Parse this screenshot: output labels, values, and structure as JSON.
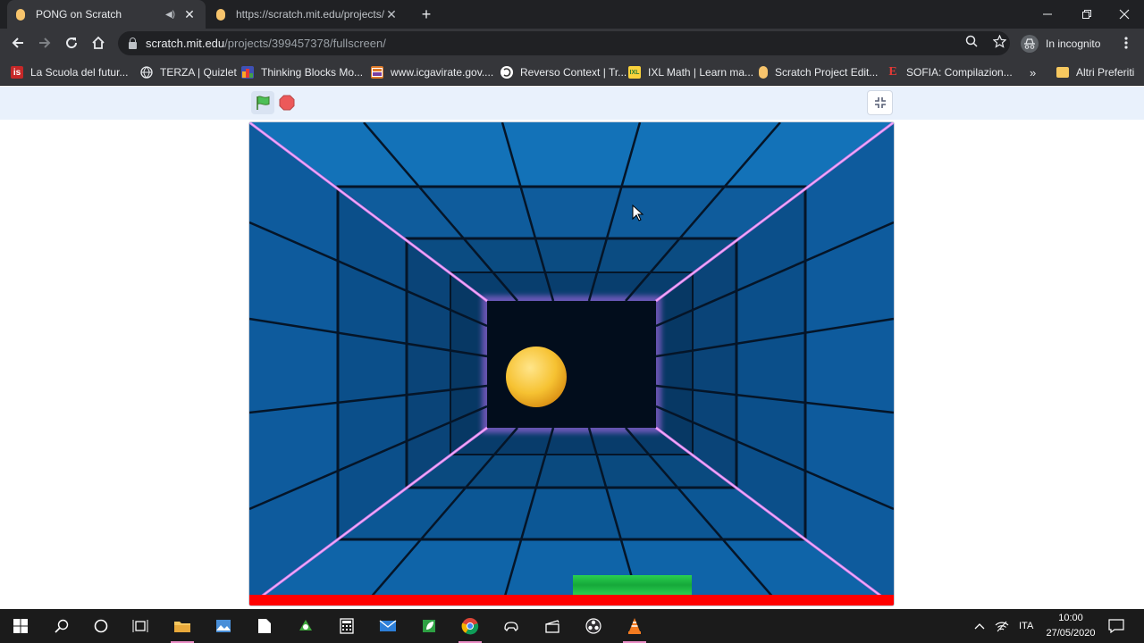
{
  "browser": {
    "tabs": [
      {
        "title": "PONG on Scratch",
        "active": true,
        "audio": true
      },
      {
        "title": "https://scratch.mit.edu/projects/",
        "active": false
      }
    ],
    "url": {
      "host": "scratch.mit.edu",
      "path": "/projects/399457378/fullscreen/"
    },
    "profile_label": "In incognito",
    "bookmarks": [
      {
        "label": "La Scuola del futur...",
        "icon": "is-icon",
        "color": "#c62828"
      },
      {
        "label": "TERZA | Quizlet",
        "icon": "globe-icon",
        "color": "#9aa0a6"
      },
      {
        "label": "Thinking Blocks Mo...",
        "icon": "thinking-blocks-icon",
        "color": "#3f51b5"
      },
      {
        "label": "www.icgavirate.gov....",
        "icon": "school-icon",
        "color": "#e07b2a"
      },
      {
        "label": "Reverso Context | Tr...",
        "icon": "reverso-icon",
        "color": "#e53935"
      },
      {
        "label": "IXL Math | Learn ma...",
        "icon": "ixl-icon",
        "color": "#f9d23c"
      },
      {
        "label": "Scratch Project Edit...",
        "icon": "scratch-icon",
        "color": "#f7c46c"
      },
      {
        "label": "SOFIA: Compilazion...",
        "icon": "e-icon",
        "color": "#c62828"
      }
    ],
    "bookmarks_overflow": "»",
    "other_bookmarks": "Altri Preferiti"
  },
  "taskbar": {
    "language": "ITA",
    "time": "10:00",
    "date": "27/05/2020"
  },
  "colors": {
    "stage_blue": "#0e5a9a",
    "neon_pink": "#e87bf0",
    "paddle_green": "#22c145",
    "bottom_bar_red": "#ff0000",
    "ball_yellow": "#f6c232"
  }
}
